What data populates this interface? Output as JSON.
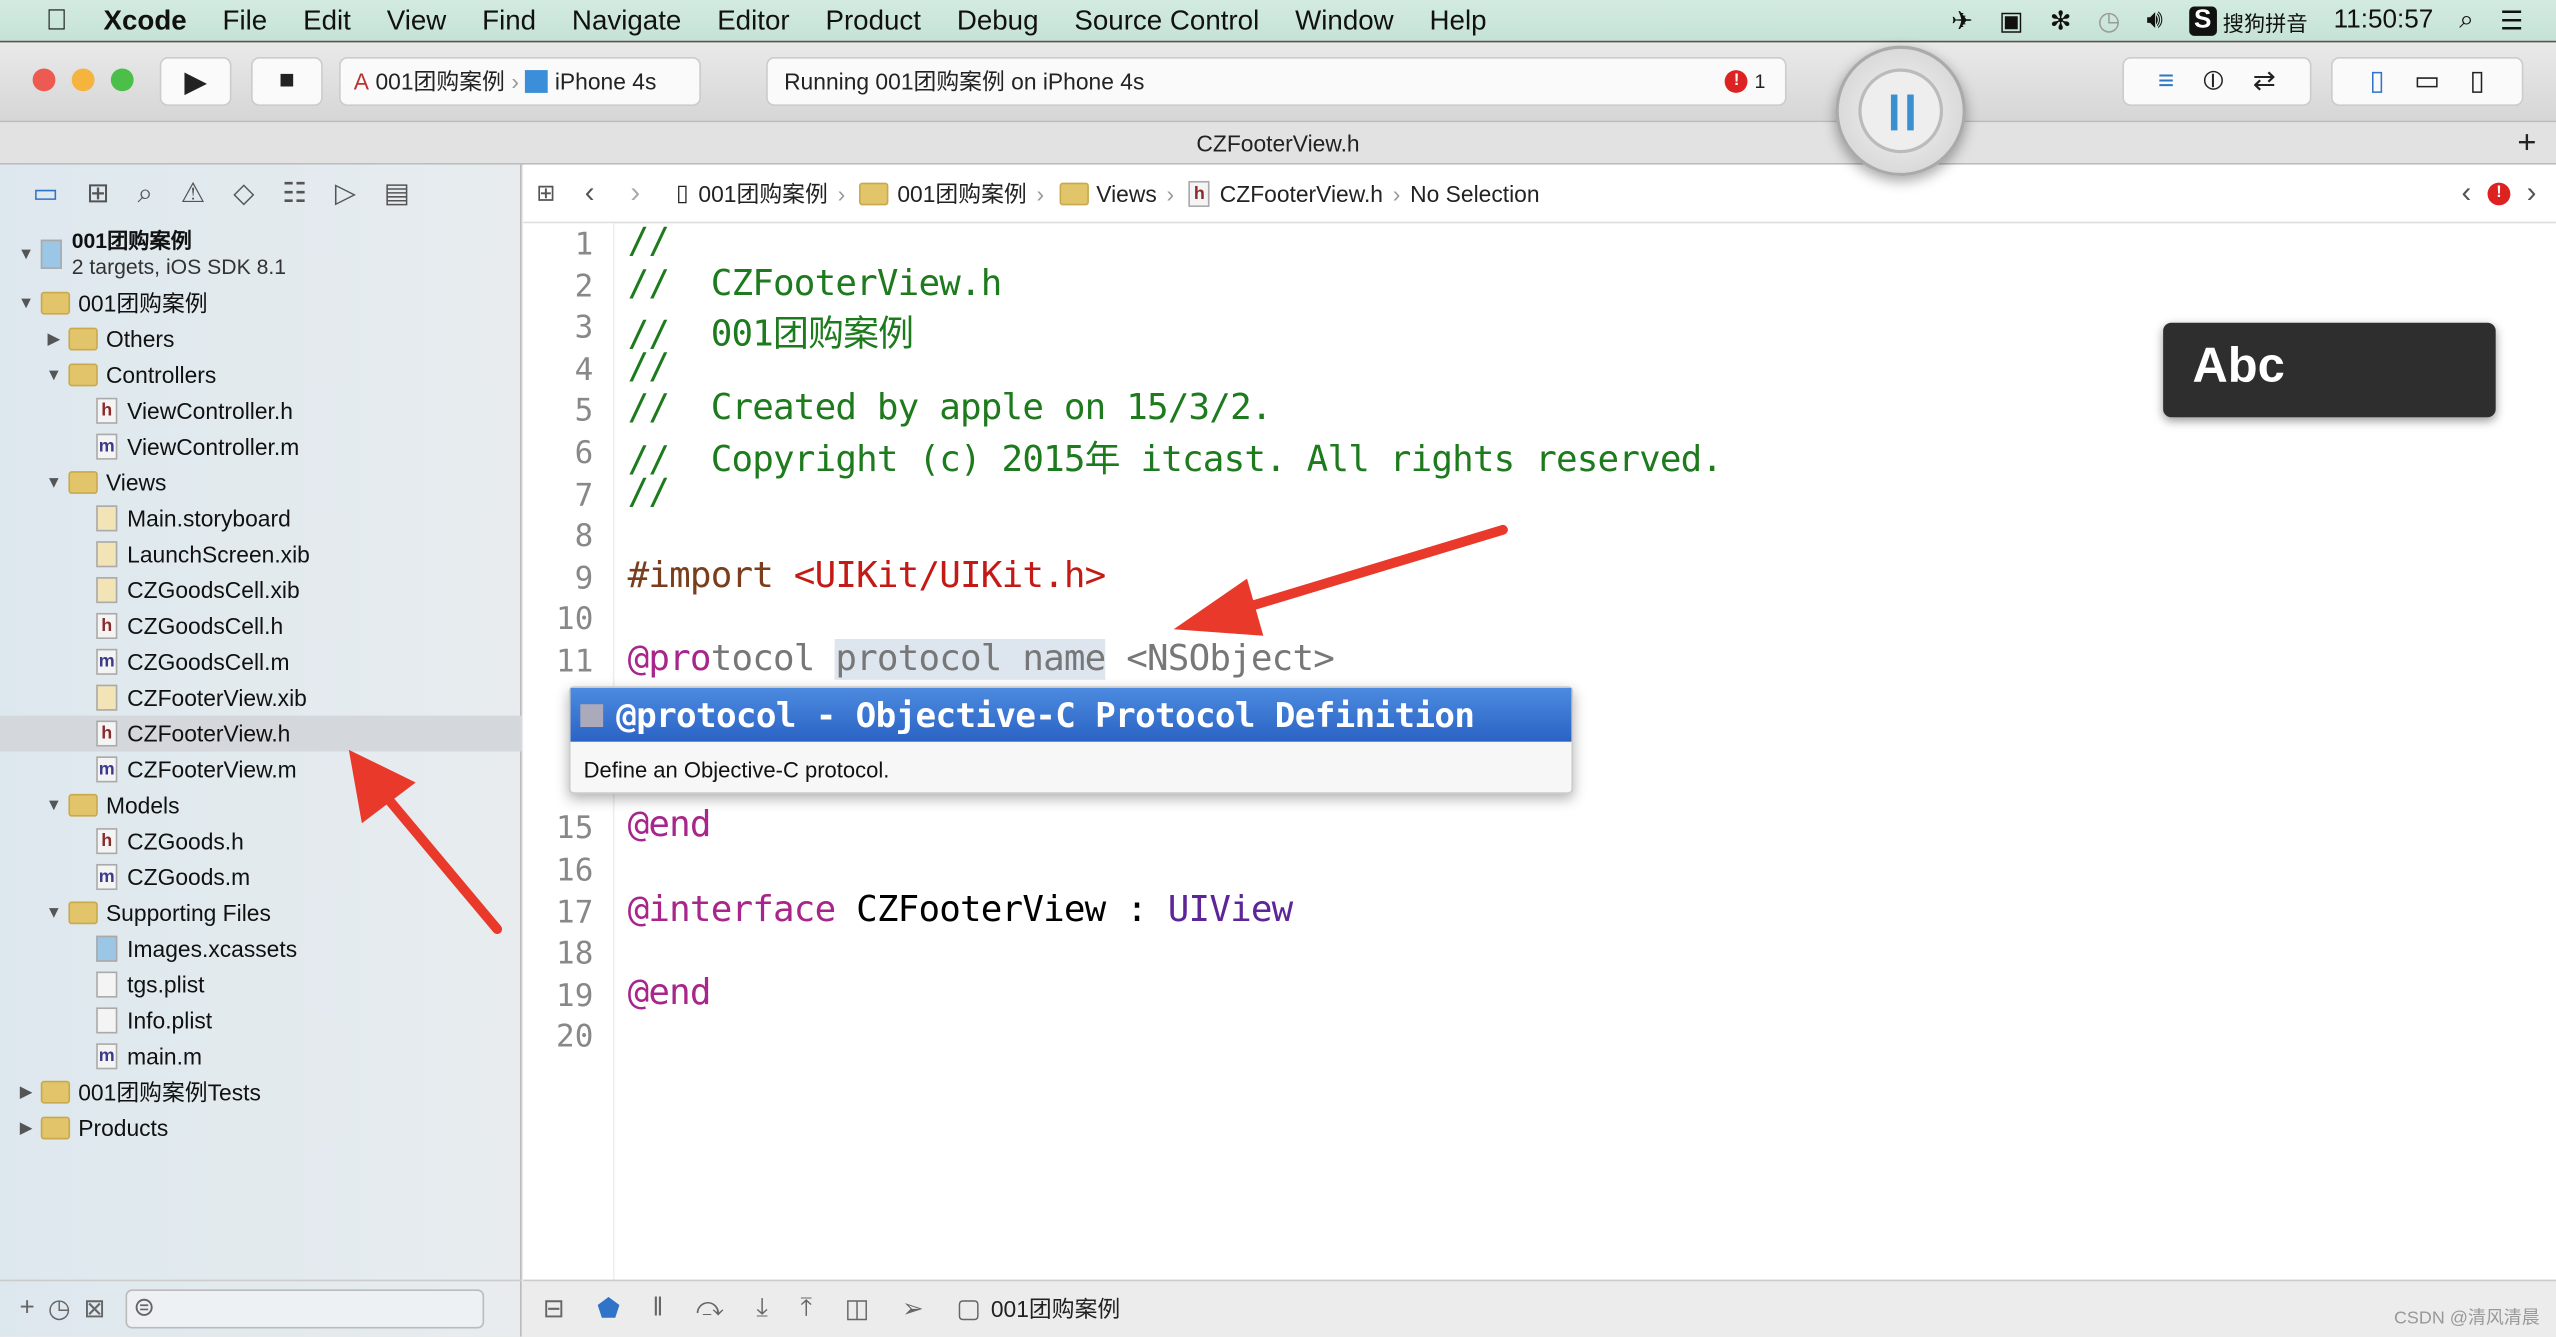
{
  "menubar": {
    "apple": "",
    "items": [
      "Xcode",
      "File",
      "Edit",
      "View",
      "Find",
      "Navigate",
      "Editor",
      "Product",
      "Debug",
      "Source Control",
      "Window",
      "Help"
    ],
    "input_method": "搜狗拼音",
    "clock": "11:50:57"
  },
  "toolbar": {
    "scheme": "001团购案例",
    "device": "iPhone 4s",
    "activity": "Running 001团购案例 on iPhone 4s",
    "error_count": "1"
  },
  "tab": {
    "title": "CZFooterView.h",
    "add": "+"
  },
  "jumpbar": {
    "items": [
      "001团购案例",
      "001团购案例",
      "Views",
      "CZFooterView.h",
      "No Selection"
    ]
  },
  "navigator": {
    "project": {
      "name": "001团购案例",
      "subtitle": "2 targets, iOS SDK 8.1"
    },
    "items": [
      {
        "level": 1,
        "type": "folder",
        "open": true,
        "label": "001团购案例"
      },
      {
        "level": 2,
        "type": "folder",
        "open": false,
        "label": "Others"
      },
      {
        "level": 2,
        "type": "folder",
        "open": true,
        "label": "Controllers"
      },
      {
        "level": 3,
        "type": "h",
        "label": "ViewController.h"
      },
      {
        "level": 3,
        "type": "m",
        "label": "ViewController.m"
      },
      {
        "level": 2,
        "type": "folder",
        "open": true,
        "label": "Views"
      },
      {
        "level": 3,
        "type": "x",
        "label": "Main.storyboard"
      },
      {
        "level": 3,
        "type": "x",
        "label": "LaunchScreen.xib"
      },
      {
        "level": 3,
        "type": "x",
        "label": "CZGoodsCell.xib"
      },
      {
        "level": 3,
        "type": "h",
        "label": "CZGoodsCell.h"
      },
      {
        "level": 3,
        "type": "m",
        "label": "CZGoodsCell.m"
      },
      {
        "level": 3,
        "type": "x",
        "label": "CZFooterView.xib"
      },
      {
        "level": 3,
        "type": "h",
        "label": "CZFooterView.h",
        "selected": true
      },
      {
        "level": 3,
        "type": "m",
        "label": "CZFooterView.m"
      },
      {
        "level": 2,
        "type": "folder",
        "open": true,
        "label": "Models"
      },
      {
        "level": 3,
        "type": "h",
        "label": "CZGoods.h"
      },
      {
        "level": 3,
        "type": "m",
        "label": "CZGoods.m"
      },
      {
        "level": 2,
        "type": "folder",
        "open": true,
        "label": "Supporting Files"
      },
      {
        "level": 3,
        "type": "a",
        "label": "Images.xcassets"
      },
      {
        "level": 3,
        "type": "p",
        "label": "tgs.plist"
      },
      {
        "level": 3,
        "type": "p",
        "label": "Info.plist"
      },
      {
        "level": 3,
        "type": "m",
        "label": "main.m"
      },
      {
        "level": 1,
        "type": "folder",
        "open": false,
        "label": "001团购案例Tests"
      },
      {
        "level": 1,
        "type": "folder",
        "open": false,
        "label": "Products"
      }
    ]
  },
  "code": {
    "lines": [
      {
        "n": "1",
        "t": "//"
      },
      {
        "n": "2",
        "t": "//  CZFooterView.h"
      },
      {
        "n": "3",
        "t": "//  001团购案例"
      },
      {
        "n": "4",
        "t": "//"
      },
      {
        "n": "5",
        "t": "//  Created by apple on 15/3/2."
      },
      {
        "n": "6",
        "t": "//  Copyright (c) 2015年 itcast. All rights reserved."
      },
      {
        "n": "7",
        "t": "//"
      },
      {
        "n": "8",
        "t": ""
      },
      {
        "n": "9",
        "t": "#import <UIKit/UIKit.h>"
      },
      {
        "n": "10",
        "t": ""
      },
      {
        "n": "11",
        "t": "@protocol protocol name <NSObject>"
      },
      {
        "n": "15",
        "t": "@end"
      },
      {
        "n": "16",
        "t": ""
      },
      {
        "n": "17",
        "t": "@interface CZFooterView : UIView"
      },
      {
        "n": "18",
        "t": ""
      },
      {
        "n": "19",
        "t": "@end"
      },
      {
        "n": "20",
        "t": ""
      }
    ]
  },
  "autocomplete": {
    "title": "@protocol - Objective-C Protocol Definition",
    "description": "Define an Objective-C protocol."
  },
  "ime_overlay": {
    "label": "Abc"
  },
  "debugbar": {
    "target": "001团购案例"
  },
  "watermark": "CSDN @清风清晨",
  "colors": {
    "annotation_arrow": "#e8392b",
    "selection_blue": "#2b63c4"
  }
}
